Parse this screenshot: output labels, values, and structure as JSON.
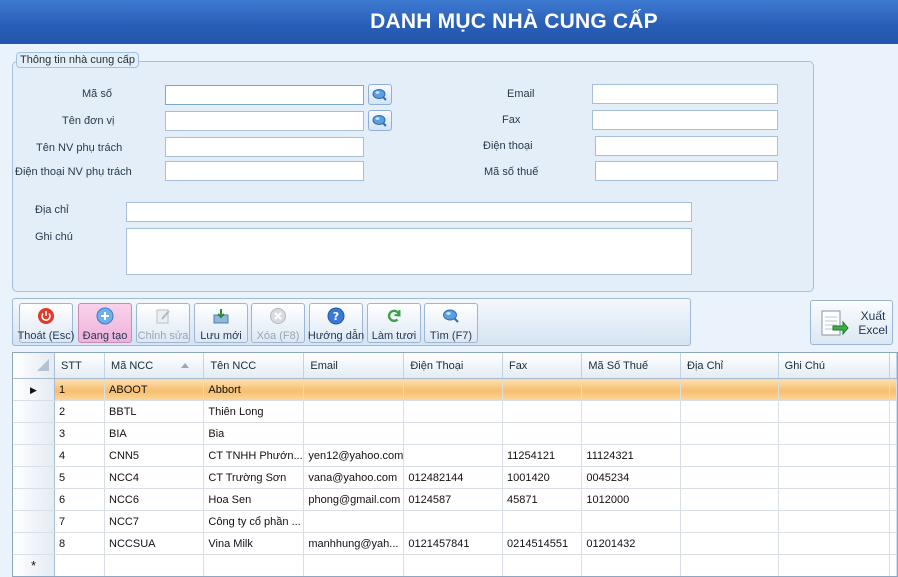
{
  "window": {
    "title": "DANH MỤC NHÀ CUNG CẤP"
  },
  "info_group": {
    "legend": "Thông tin nhà cung cấp",
    "fields": {
      "ma_so": {
        "label": "Mã số",
        "value": ""
      },
      "ten_don_vi": {
        "label": "Tên đơn vị",
        "value": ""
      },
      "ten_nv": {
        "label": "Tên NV phụ trách",
        "value": ""
      },
      "dien_thoai_nv": {
        "label": "Điện thoại NV phụ trách",
        "value": ""
      },
      "email": {
        "label": "Email",
        "value": ""
      },
      "fax": {
        "label": "Fax",
        "value": ""
      },
      "dien_thoai": {
        "label": "Điện thoại",
        "value": ""
      },
      "ma_so_thue": {
        "label": "Mã số thuế",
        "value": ""
      },
      "dia_chi": {
        "label": "Địa chỉ",
        "value": ""
      },
      "ghi_chu": {
        "label": "Ghi chú",
        "value": ""
      }
    }
  },
  "toolbar": {
    "buttons": [
      {
        "label": "Thoát (Esc)",
        "icon": "power-icon",
        "state": "normal"
      },
      {
        "label": "Đang tạo",
        "icon": "plus-circle-icon",
        "state": "active"
      },
      {
        "label": "Chỉnh sửa",
        "icon": "edit-icon",
        "state": "disabled"
      },
      {
        "label": "Lưu mới",
        "icon": "save-icon",
        "state": "normal"
      },
      {
        "label": "Xóa (F8)",
        "icon": "delete-icon",
        "state": "disabled"
      },
      {
        "label": "Hướng dẫn",
        "icon": "help-icon",
        "state": "normal"
      },
      {
        "label": "Làm tươi",
        "icon": "refresh-icon",
        "state": "normal"
      },
      {
        "label": "Tìm (F7)",
        "icon": "search-icon",
        "state": "normal"
      }
    ],
    "excel_label": "Xuất Excel"
  },
  "grid": {
    "columns": [
      "STT",
      "Mã NCC",
      "Tên NCC",
      "Email",
      "Điện Thoại",
      "Fax",
      "Mã Số Thuế",
      "Địa Chỉ",
      "Ghi Chú"
    ],
    "rows": [
      [
        "1",
        "ABOOT",
        "Abbort",
        "",
        "",
        "",
        "",
        "",
        ""
      ],
      [
        "2",
        "BBTL",
        "Thiên Long",
        "",
        "",
        "",
        "",
        "",
        ""
      ],
      [
        "3",
        "BIA",
        "Bia",
        "",
        "",
        "",
        "",
        "",
        ""
      ],
      [
        "4",
        "CNN5",
        "CT TNHH Phướn...",
        "yen12@yahoo.com",
        "",
        "11254121",
        "11124321",
        "",
        ""
      ],
      [
        "5",
        "NCC4",
        "CT Trường Sơn",
        "vana@yahoo.com",
        "012482144",
        "1001420",
        "0045234",
        "",
        ""
      ],
      [
        "6",
        "NCC6",
        "Hoa Sen",
        "phong@gmail.com",
        "0124587",
        "45871",
        "1012000",
        "",
        ""
      ],
      [
        "7",
        "NCC7",
        "Công ty cổ phần ...",
        "",
        "",
        "",
        "",
        "",
        ""
      ],
      [
        "8",
        "NCCSUA",
        "Vina Milk",
        "manhhung@yah...",
        "0121457841",
        "0214514551",
        "01201432",
        "",
        ""
      ]
    ],
    "selected_row": 0,
    "new_row_marker": "*",
    "current_row_marker": "▶"
  },
  "colors": {
    "title_bar": "#2a5fb8",
    "selected_row": "#f8be6e",
    "active_button": "#eeb2dc"
  }
}
